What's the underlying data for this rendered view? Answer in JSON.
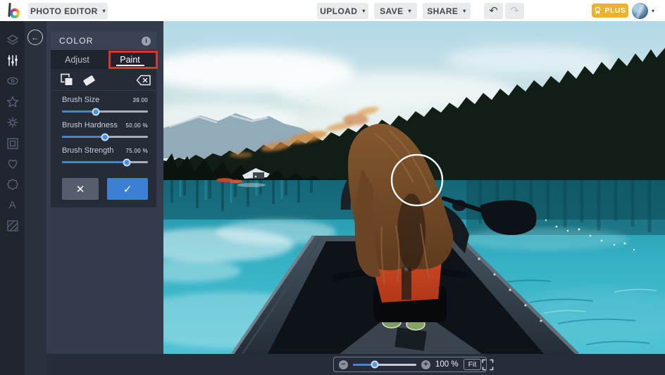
{
  "topbar": {
    "app_menu": "PHOTO EDITOR",
    "upload": "UPLOAD",
    "save": "SAVE",
    "share": "SHARE",
    "caret": "▾",
    "undo_icon": "↶",
    "redo_icon": "↷",
    "plus_label": "PLUS",
    "plus_color": "#ecb22c"
  },
  "sidebar": {
    "items": [
      {
        "name": "layers"
      },
      {
        "name": "edit",
        "active": true
      },
      {
        "name": "effects"
      },
      {
        "name": "favorites"
      },
      {
        "name": "artsy"
      },
      {
        "name": "frames"
      },
      {
        "name": "graphics"
      },
      {
        "name": "overlays"
      },
      {
        "name": "text",
        "glyph": "A"
      },
      {
        "name": "textures"
      }
    ],
    "back_icon": "←"
  },
  "panel": {
    "title": "COLOR",
    "info_icon": "i",
    "tabs": [
      {
        "label": "Adjust",
        "active": false
      },
      {
        "label": "Paint",
        "active": true
      }
    ],
    "sliders": [
      {
        "label": "Brush Size",
        "value": "39.00",
        "percent": 39
      },
      {
        "label": "Brush Hardness",
        "value": "50.00 %",
        "percent": 50
      },
      {
        "label": "Brush Strength",
        "value": "75.00 %",
        "percent": 75
      }
    ],
    "cancel_icon": "✕",
    "apply_icon": "✓",
    "accent_blue": "#3c7fd3"
  },
  "annotation": {
    "color": "#d6392a",
    "target": "Paint tab"
  },
  "zoombar": {
    "minus_icon": "−",
    "plus_icon": "+",
    "level": "100 %",
    "fit_label": "Fit",
    "percent": 34
  }
}
